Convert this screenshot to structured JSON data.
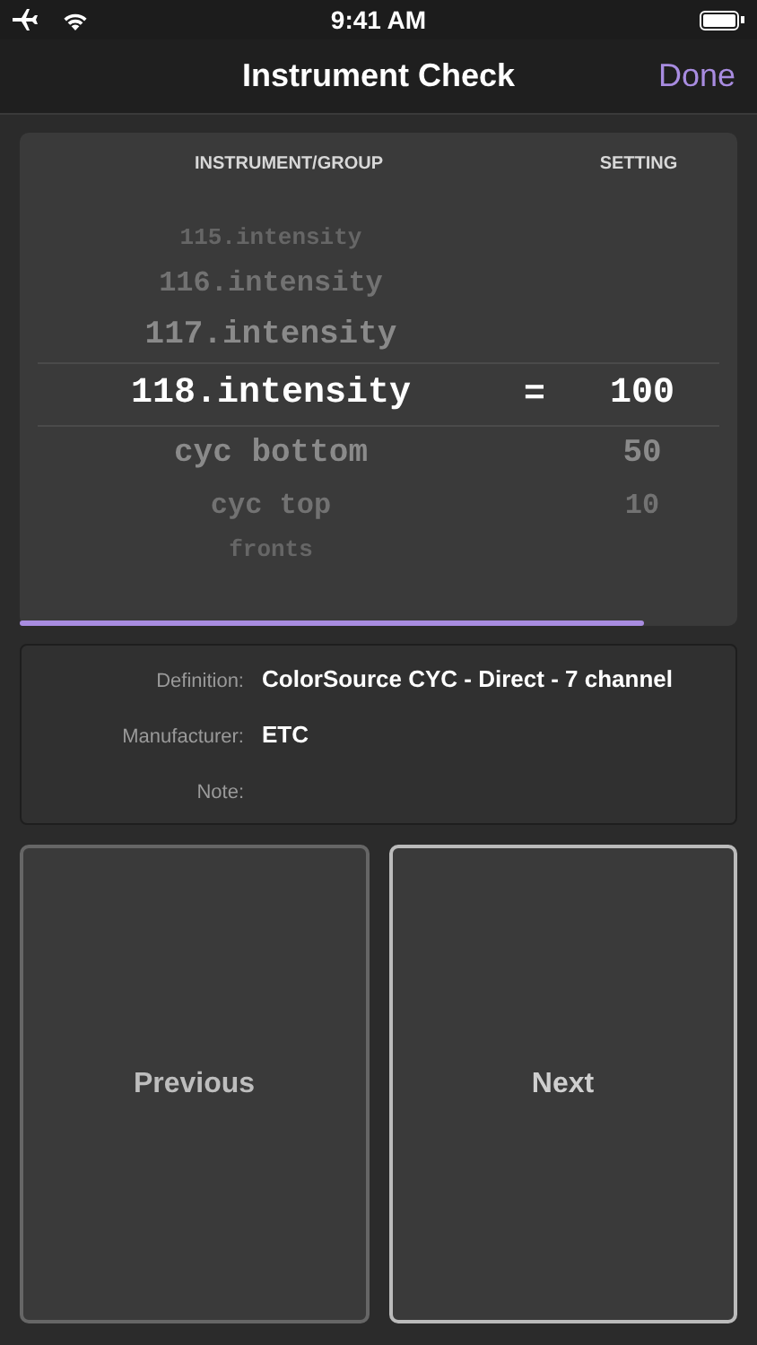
{
  "status_bar": {
    "time": "9:41 AM"
  },
  "nav": {
    "title": "Instrument Check",
    "done": "Done"
  },
  "picker": {
    "columns": [
      "INSTRUMENT/GROUP",
      "SETTING"
    ],
    "separator": "=",
    "rows": [
      {
        "name": "115.intensity",
        "selected": false
      },
      {
        "name": "116.intensity",
        "selected": false
      },
      {
        "name": "117.intensity",
        "selected": false
      },
      {
        "name": "118.intensity",
        "value": "100",
        "selected": true
      },
      {
        "name": "cyc bottom",
        "value": "50",
        "selected": false
      },
      {
        "name": "cyc top",
        "value": "10",
        "selected": false
      },
      {
        "name": "fronts",
        "selected": false
      }
    ],
    "progress": {
      "level": 0.87
    }
  },
  "details": [
    {
      "label": "Definition:",
      "value": "ColorSource CYC - Direct - 7 channel"
    },
    {
      "label": "Manufacturer:",
      "value": "ETC"
    },
    {
      "label": "Note:"
    }
  ],
  "buttons": [
    {
      "label": "Previous",
      "kind": "previous"
    },
    {
      "label": "Next",
      "kind": "next"
    }
  ]
}
